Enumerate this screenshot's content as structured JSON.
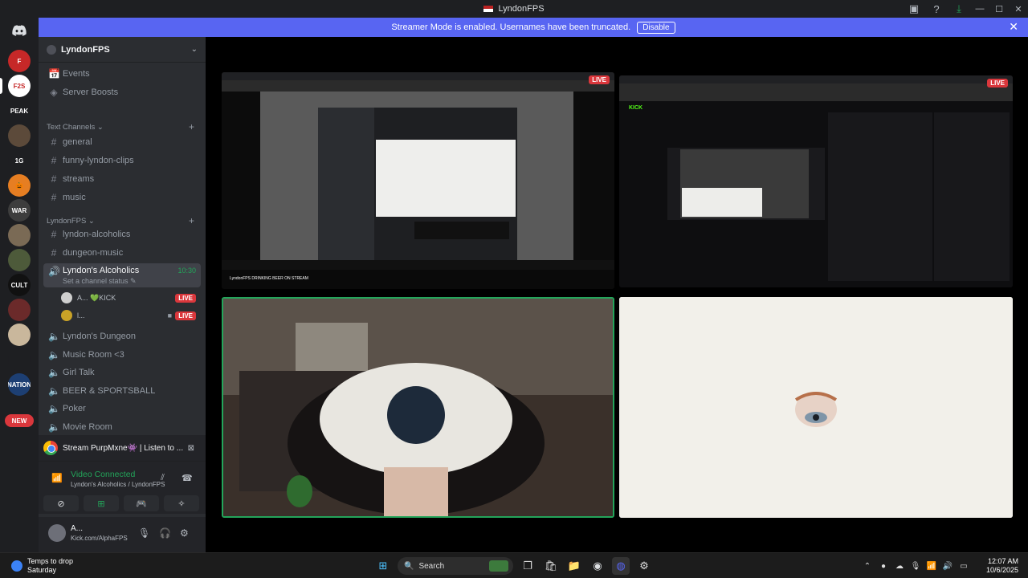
{
  "window": {
    "title": "LyndonFPS"
  },
  "banner": {
    "message": "Streamer Mode is enabled. Usernames have been truncated.",
    "disable_label": "Disable",
    "close_glyph": "✕"
  },
  "rail": {
    "servers": [
      {
        "name": "server-1",
        "color": "#c62828",
        "label": "F"
      },
      {
        "name": "server-lyndonfps",
        "color": "#ffffff",
        "label": "F2S"
      },
      {
        "name": "server-3",
        "color": "#1e1f22",
        "label": "PEAK"
      },
      {
        "name": "server-4",
        "color": "#5c4a3a",
        "label": ""
      },
      {
        "name": "server-5",
        "color": "#1e1f22",
        "label": "1G"
      },
      {
        "name": "server-6",
        "color": "#e67e22",
        "label": "🎃"
      },
      {
        "name": "server-7",
        "color": "#3d3d3d",
        "label": "WAR"
      },
      {
        "name": "server-8",
        "color": "#7a6a55",
        "label": ""
      },
      {
        "name": "server-9",
        "color": "#4d5a3a",
        "label": ""
      },
      {
        "name": "server-10",
        "color": "#111111",
        "label": "CULT"
      },
      {
        "name": "server-11",
        "color": "#6b2a2a",
        "label": ""
      },
      {
        "name": "server-12",
        "color": "#c9b79c",
        "label": ""
      },
      {
        "name": "server-13",
        "color": "#1e1f22",
        "label": ""
      },
      {
        "name": "server-14",
        "color": "#1d3f73",
        "label": "NATION"
      }
    ],
    "new_badge": "NEW"
  },
  "sidebar": {
    "server_name": "LyndonFPS",
    "top_items": [
      {
        "label": "Events",
        "icon": "📅"
      },
      {
        "label": "Server Boosts",
        "icon": "◈"
      }
    ],
    "category_text": "Text Channels",
    "text_channels": [
      "general",
      "funny-lyndon-clips",
      "streams",
      "music"
    ],
    "category_fps": "LyndonFPS",
    "fps_channels": [
      "lyndon-alcoholics",
      "dungeon-music"
    ],
    "active_voice": {
      "label": "Lyndon's Alcoholics",
      "time": "10:30",
      "status": "Set a channel status ✎"
    },
    "voice_users": [
      {
        "name": "A... 💚KICK",
        "live": "LIVE",
        "avatar": "#cfcfcf"
      },
      {
        "name": "l...",
        "live": "LIVE",
        "avatar": "#c9a227"
      }
    ],
    "voice_channels": [
      "Lyndon's Dungeon",
      "Music Room <3",
      "Girl Talk",
      "BEER & SPORTSBALL",
      "Poker",
      "Movie Room"
    ]
  },
  "activity": {
    "text": "Stream PurpMxne👾 | Listen to ..."
  },
  "voice_panel": {
    "title": "Video Connected",
    "subtitle": "Lyndon's Alcoholics / LyndonFPS"
  },
  "user_panel": {
    "name": "A...",
    "status": "Kick.com/AlphaFPS"
  },
  "stage": {
    "live_label": "LIVE",
    "tile1_caption": "LyndonFPS DRINKING BEER ON STREAM",
    "tile2_brand": "KICK"
  },
  "taskbar": {
    "weather_line1": "Temps to drop",
    "weather_line2": "Saturday",
    "search_label": "Search",
    "time": "12:07 AM",
    "date": "10/6/2025"
  },
  "colors": {
    "accent": "#5865f2",
    "online": "#23a55a",
    "live": "#da373c"
  }
}
